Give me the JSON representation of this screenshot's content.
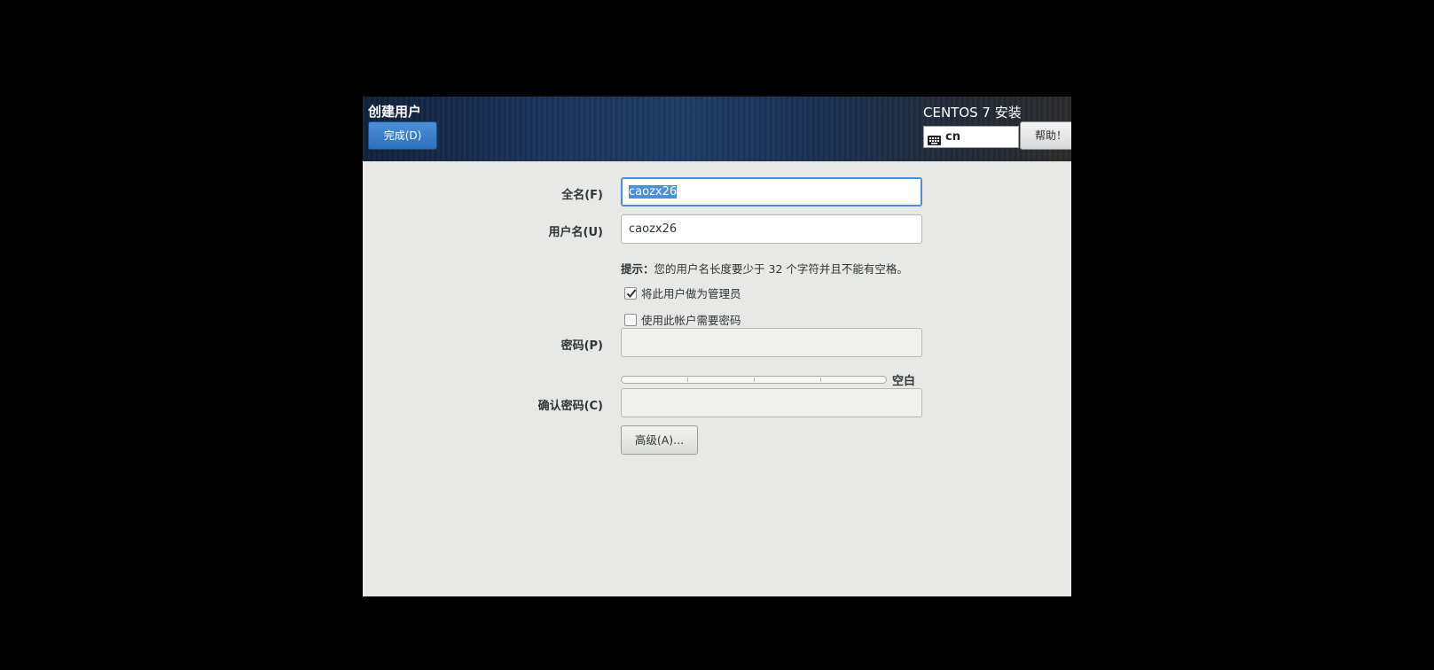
{
  "header": {
    "title": "创建用户",
    "done_label": "完成(D)",
    "product_title": "CENTOS 7 安装",
    "keyboard_layout": "cn",
    "help_label": "帮助！"
  },
  "form": {
    "fullname": {
      "label": "全名(F)",
      "value": "caozx26",
      "selected": true
    },
    "username": {
      "label": "用户名(U)",
      "value": "caozx26"
    },
    "hint_prefix": "提示：",
    "hint_text": "您的用户名长度要少于 32 个字符并且不能有空格。",
    "admin_checkbox": {
      "label": "将此用户做为管理员",
      "checked": true
    },
    "require_password_checkbox": {
      "label": "使用此帐户需要密码",
      "checked": false
    },
    "password": {
      "label": "密码(P)",
      "value": ""
    },
    "strength": {
      "label": "空白",
      "level": 0
    },
    "confirm_password": {
      "label": "确认密码(C)",
      "value": ""
    },
    "advanced_label": "高级(A)..."
  },
  "icons": {
    "keyboard": "keyboard-icon",
    "check": "check-icon"
  },
  "colors": {
    "accent": "#4a90d9",
    "done_button": "#3a7dcb"
  }
}
